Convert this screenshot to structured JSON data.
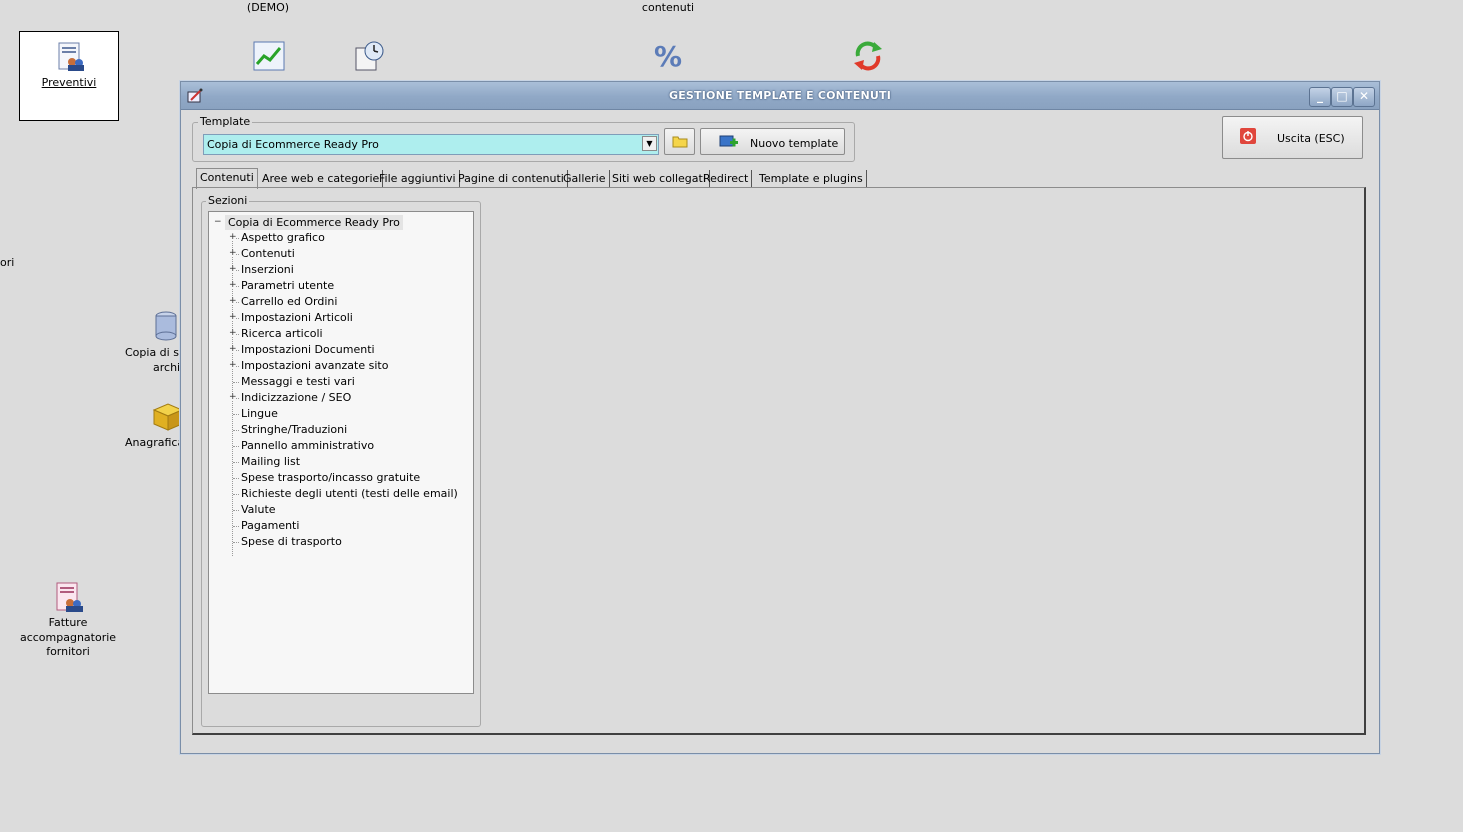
{
  "desktop": {
    "top_label_1": "(DEMO)",
    "top_label_2": "contenuti",
    "preventivi": "Preventivi",
    "side_fragment": "ori",
    "copia_line1": "Copia di sic",
    "copia_line2": "archiv",
    "anagrafica": "Anagrafica",
    "fatture_line1": "Fatture",
    "fatture_line2": "accompagnatorie",
    "fatture_line3": "fornitori",
    "icons": [
      "report-icon",
      "chart-icon",
      "scheduler-icon",
      "percent-icon",
      "refresh-arrows-icon",
      "database-icon",
      "package-icon",
      "invoice-icon"
    ]
  },
  "window": {
    "title": "GESTIONE TEMPLATE E CONTENUTI",
    "controls": [
      "_",
      "□",
      "✕"
    ],
    "template_group_label": "Template",
    "template_selected": "Copia di Ecommerce Ready Pro",
    "new_template_label": "Nuovo template",
    "exit_label": "Uscita (ESC)",
    "tabs": [
      "Contenuti",
      "Aree web e categorie",
      "File aggiuntivi",
      "Pagine di contenuti",
      "Gallerie",
      "Siti web collegati",
      "Redirect",
      "Template e plugins"
    ],
    "active_tab_index": 0,
    "sections_label": "Sezioni",
    "tree_root": "Copia di Ecommerce Ready Pro",
    "tree_items": [
      {
        "label": "Aspetto grafico",
        "expandable": true
      },
      {
        "label": "Contenuti",
        "expandable": true
      },
      {
        "label": "Inserzioni",
        "expandable": true
      },
      {
        "label": "Parametri utente",
        "expandable": true
      },
      {
        "label": "Carrello ed Ordini",
        "expandable": true
      },
      {
        "label": "Impostazioni Articoli",
        "expandable": true
      },
      {
        "label": "Ricerca articoli",
        "expandable": true
      },
      {
        "label": "Impostazioni Documenti",
        "expandable": true
      },
      {
        "label": "Impostazioni avanzate sito",
        "expandable": true
      },
      {
        "label": "Messaggi e testi vari",
        "expandable": false
      },
      {
        "label": "Indicizzazione / SEO",
        "expandable": true
      },
      {
        "label": "Lingue",
        "expandable": false
      },
      {
        "label": "Stringhe/Traduzioni",
        "expandable": false
      },
      {
        "label": "Pannello amministrativo",
        "expandable": false
      },
      {
        "label": "Mailing list",
        "expandable": false
      },
      {
        "label": "Spese trasporto/incasso gratuite",
        "expandable": false
      },
      {
        "label": "Richieste degli utenti (testi delle email)",
        "expandable": false
      },
      {
        "label": "Valute",
        "expandable": false
      },
      {
        "label": "Pagamenti",
        "expandable": false
      },
      {
        "label": "Spese di trasporto",
        "expandable": false
      }
    ]
  },
  "colors": {
    "desktop_bg": "#dcdcdc",
    "titlebar": "#90a8c6",
    "combo_bg": "#aeeeee",
    "exit_icon": "#e0463c"
  }
}
